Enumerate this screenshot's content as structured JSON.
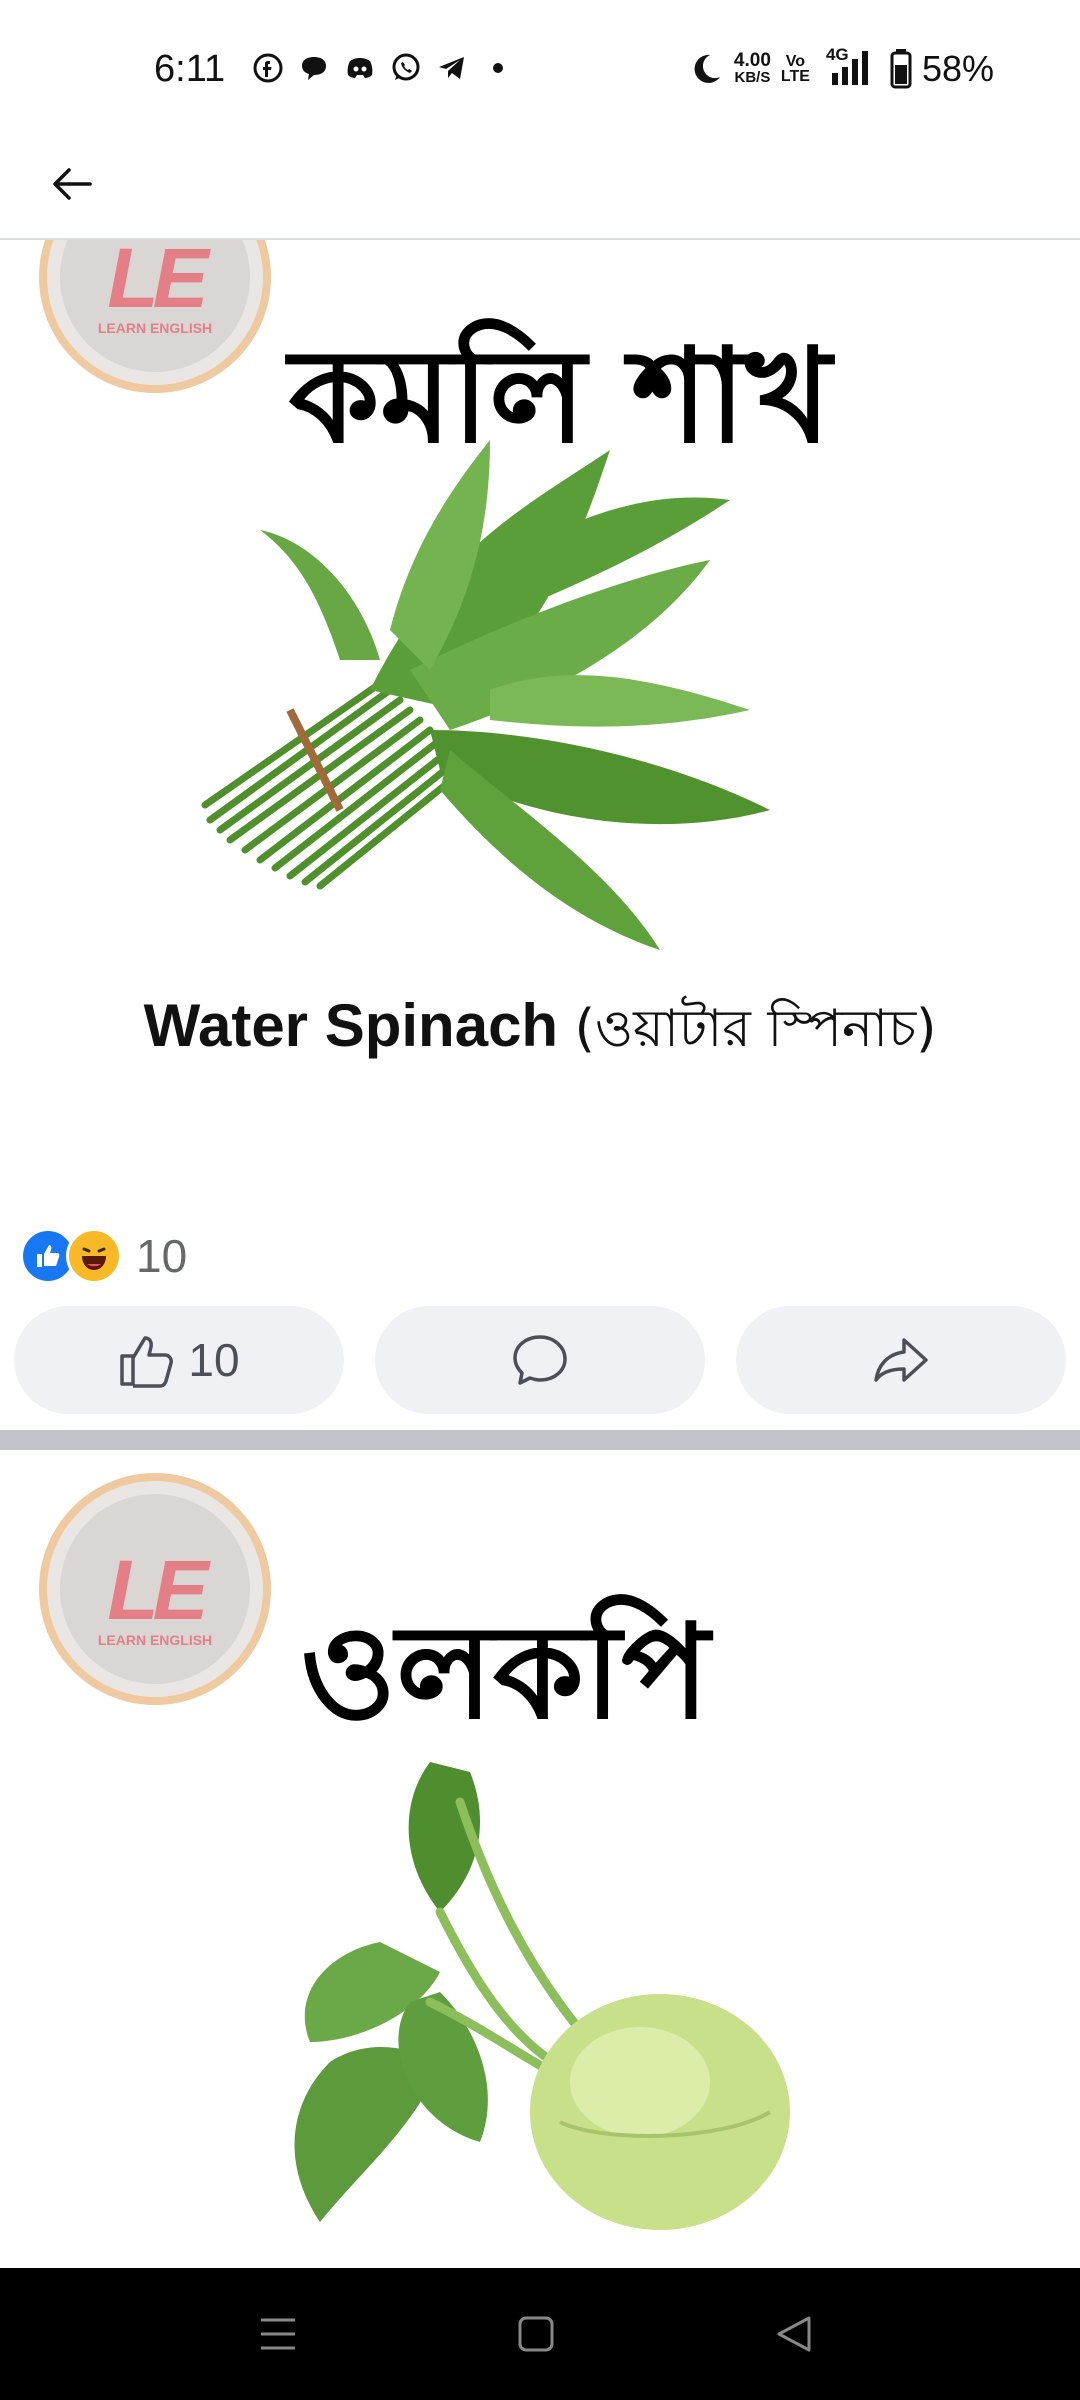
{
  "status_bar": {
    "time": "6:11",
    "net_speed_value": "4.00",
    "net_speed_unit": "KB/S",
    "volte_top": "Vo",
    "volte_bottom": "LTE",
    "signal_label": "4G",
    "battery": "58%",
    "app_icons": [
      "facebook-icon",
      "chat-bubble-icon",
      "discord-icon",
      "whatsapp-icon",
      "telegram-icon",
      "dot-icon"
    ]
  },
  "header": {
    "back_icon": "arrow-left-icon"
  },
  "posts": [
    {
      "title_bn": "কমলি শাখ",
      "caption_en": "Water Spinach",
      "caption_bn": " (ওয়াটার স্পিনাচ)",
      "logo_text": "LE",
      "logo_sub": "LEARN ENGLISH",
      "reaction_count": "10",
      "like_count": "10"
    },
    {
      "title_bn": "ওলকপি",
      "logo_text": "LE",
      "logo_sub": "LEARN ENGLISH"
    }
  ],
  "colors": {
    "facebook_blue": "#1877f2",
    "haha_yellow": "#f7b928",
    "button_bg": "#eff1f4",
    "separator": "#c0c4ca",
    "leaf_green": "#5a9e3a",
    "kohlrabi": "#c9e08a"
  },
  "nav_icons": [
    "menu-icon",
    "home-square-icon",
    "back-triangle-icon"
  ]
}
